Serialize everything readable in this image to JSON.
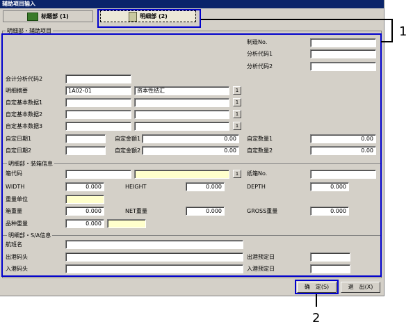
{
  "window": {
    "title": "辅助项目输入"
  },
  "tabs": [
    {
      "label": "标题部 (1)"
    },
    {
      "label": "明细部 (2)"
    }
  ],
  "sections": {
    "main": "明细部・辅助项目",
    "packing": "明细部・装箱信息",
    "sa": "明细部・S/A信息"
  },
  "fields": {
    "manufacture_no": {
      "label": "制造No.",
      "value": ""
    },
    "analysis_code1": {
      "label": "分析代码1",
      "value": ""
    },
    "analysis_code2": {
      "label": "分析代码2",
      "value": ""
    },
    "acct_analysis_code2": {
      "label": "会计分析代码2",
      "value": ""
    },
    "detail_summary": {
      "label": "明细摘要",
      "code": "1A02-01",
      "name": "资本性结汇"
    },
    "custom_basic1": {
      "label": "自定基本数据1"
    },
    "custom_basic2": {
      "label": "自定基本数据2"
    },
    "custom_basic3": {
      "label": "自定基本数据3"
    },
    "custom_date1": {
      "label": "自定日期1"
    },
    "custom_date2": {
      "label": "自定日期2"
    },
    "custom_amount1": {
      "label": "自定金额1",
      "value": "0.00"
    },
    "custom_amount2": {
      "label": "自定金额2",
      "value": "0.00"
    },
    "custom_qty1": {
      "label": "自定数量1",
      "value": "0.00"
    },
    "custom_qty2": {
      "label": "自定数量2",
      "value": "0.00"
    },
    "box_code": {
      "label": "箱代码"
    },
    "carton_no": {
      "label": "纸箱No."
    },
    "width": {
      "label": "WIDTH",
      "value": "0.000"
    },
    "height": {
      "label": "HEIGHT",
      "value": "0.000"
    },
    "depth": {
      "label": "DEPTH",
      "value": "0.000"
    },
    "weight_unit": {
      "label": "重量单位"
    },
    "box_weight": {
      "label": "箱重量",
      "value": "0.000"
    },
    "net_weight": {
      "label": "NET重量",
      "value": "0.000"
    },
    "gross_weight": {
      "label": "GROSS重量",
      "value": "0.000"
    },
    "item_weight": {
      "label": "品种重量",
      "value": "0.000"
    },
    "voyage": {
      "label": "航班名"
    },
    "dep_port": {
      "label": "出港码头"
    },
    "dep_date": {
      "label": "出港预定日"
    },
    "arr_port": {
      "label": "入港码头"
    },
    "arr_date": {
      "label": "入港预定日"
    }
  },
  "select_btn": "1",
  "buttons": {
    "ok": "确　定(S)",
    "exit": "退　出(X)"
  },
  "annotations": {
    "a1": "1",
    "a2": "2"
  }
}
